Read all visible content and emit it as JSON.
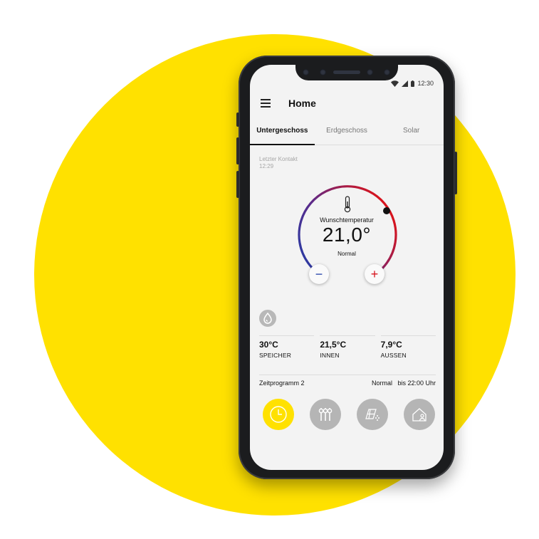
{
  "status_bar": {
    "time": "12:30"
  },
  "header": {
    "title": "Home"
  },
  "tabs": [
    {
      "label": "Untergeschoss",
      "active": true
    },
    {
      "label": "Erdgeschoss",
      "active": false
    },
    {
      "label": "Solar",
      "active": false
    }
  ],
  "last_contact": {
    "label": "Letzter Kontakt",
    "time": "12:29"
  },
  "thermostat": {
    "label": "Wunschtemperatur",
    "value": "21,0°",
    "mode": "Normal",
    "minus_symbol": "−",
    "plus_symbol": "+",
    "cold_color": "#1f3fa8",
    "hot_color": "#d7141e"
  },
  "readings": [
    {
      "value": "30°C",
      "label": "SPEICHER"
    },
    {
      "value": "21,5°C",
      "label": "INNEN"
    },
    {
      "value": "7,9°C",
      "label": "AUSSEN"
    }
  ],
  "program": {
    "name": "Zeitprogramm 2",
    "status": "Normal   bis 22:00 Uhr"
  },
  "bottom_nav": [
    {
      "icon": "clock-icon",
      "color": "#FFE100"
    },
    {
      "icon": "sliders-icon",
      "color": "#b5b5b5"
    },
    {
      "icon": "solar-water-icon",
      "color": "#b5b5b5"
    },
    {
      "icon": "house-person-icon",
      "color": "#b5b5b5"
    }
  ],
  "colors": {
    "brand_yellow": "#FFE100",
    "phone_body": "#1b1c1e",
    "screen_bg": "#f3f3f3"
  }
}
